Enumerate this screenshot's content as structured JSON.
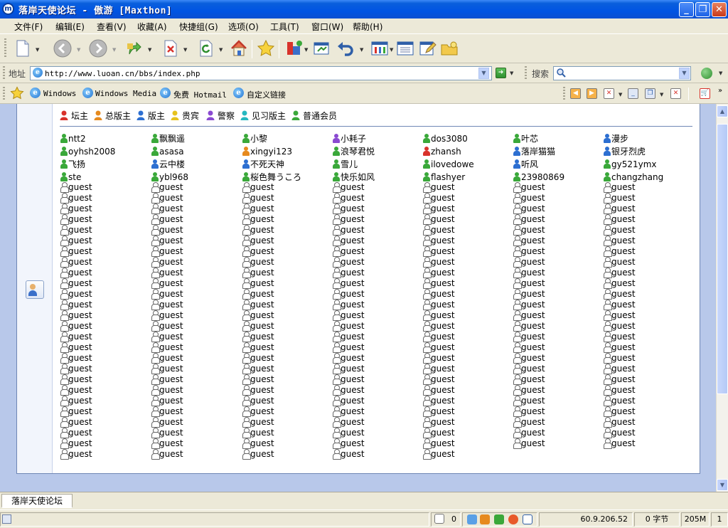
{
  "window": {
    "title": "落岸天使论坛 - 傲游 [Maxthon]",
    "app_icon": "m",
    "minimize": "_",
    "maximize": "❐",
    "close": "✕"
  },
  "menu": [
    "文件(F)",
    "编辑(E)",
    "查看(V)",
    "收藏(A)",
    "快捷组(G)",
    "选项(O)",
    "工具(T)",
    "窗口(W)",
    "帮助(H)"
  ],
  "toolbar": {
    "icons": [
      "new-page-icon",
      "back-icon",
      "forward-icon",
      "go-up-icon",
      "stop-icon",
      "refresh-icon",
      "home-icon",
      "favorites-star-icon",
      "toolbox-icon",
      "window-icon",
      "undo-icon",
      "columns-icon",
      "list-icon",
      "edit-icon",
      "folder-icon"
    ]
  },
  "address": {
    "label": "地址",
    "url": "http://www.luoan.cn/bbs/index.php",
    "search_label": "搜索",
    "search_value": ""
  },
  "links": [
    "Windows",
    "Windows Media",
    "免费 Hotmail",
    "自定义链接"
  ],
  "legend": [
    {
      "label": "坛主",
      "color": "#d8322b"
    },
    {
      "label": "总版主",
      "color": "#e68a1e"
    },
    {
      "label": "版主",
      "color": "#2d6fd1"
    },
    {
      "label": "贵宾",
      "color": "#e6c21e"
    },
    {
      "label": "警察",
      "color": "#8a4ad1"
    },
    {
      "label": "见习版主",
      "color": "#25b8c0"
    },
    {
      "label": "普通会员",
      "color": "#3aa83a"
    }
  ],
  "members": [
    {
      "name": "ntt2",
      "color": "#3aa83a"
    },
    {
      "name": "飘飘遥",
      "color": "#3aa83a"
    },
    {
      "name": "小黎",
      "color": "#3aa83a"
    },
    {
      "name": "小耗子",
      "color": "#8a4ad1"
    },
    {
      "name": "dos3080",
      "color": "#3aa83a"
    },
    {
      "name": "叶芯",
      "color": "#3aa83a"
    },
    {
      "name": "漫步",
      "color": "#2d6fd1"
    },
    {
      "name": "oyhsh2008",
      "color": "#3aa83a"
    },
    {
      "name": "asasa",
      "color": "#3aa83a"
    },
    {
      "name": "xingyi123",
      "color": "#e68a1e"
    },
    {
      "name": "浪琴君悦",
      "color": "#3aa83a"
    },
    {
      "name": "zhansh",
      "color": "#d8322b"
    },
    {
      "name": "落岸猫猫",
      "color": "#2d6fd1"
    },
    {
      "name": "银牙烈虎",
      "color": "#2d6fd1"
    },
    {
      "name": "飞扬",
      "color": "#3aa83a"
    },
    {
      "name": "云中楼",
      "color": "#2d6fd1"
    },
    {
      "name": "不死天神",
      "color": "#2d6fd1"
    },
    {
      "name": "雪儿",
      "color": "#3aa83a"
    },
    {
      "name": "ilovedowe",
      "color": "#3aa83a"
    },
    {
      "name": "听风",
      "color": "#2d6fd1"
    },
    {
      "name": "gy521ymx",
      "color": "#3aa83a"
    },
    {
      "name": "ste",
      "color": "#3aa83a"
    },
    {
      "name": "ybl968",
      "color": "#3aa83a"
    },
    {
      "name": "桜色舞うころ",
      "color": "#3aa83a"
    },
    {
      "name": "快乐如风",
      "color": "#3aa83a"
    },
    {
      "name": "flashyer",
      "color": "#3aa83a"
    },
    {
      "name": "23980869",
      "color": "#3aa83a"
    },
    {
      "name": "changzhang",
      "color": "#3aa83a"
    }
  ],
  "guest_label": "guest",
  "guest_count": 180,
  "tabs": [
    "落岸天使论坛"
  ],
  "status": {
    "popup_count": "0",
    "ip": "60.9.206.52",
    "bytes": "0 字节",
    "memory": "205M",
    "page": "1"
  }
}
